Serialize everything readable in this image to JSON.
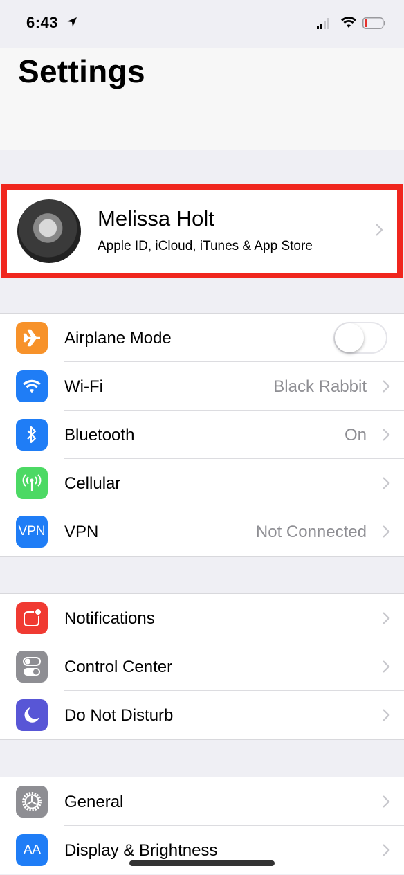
{
  "status_bar": {
    "time": "6:43",
    "battery_color": "#e5322d"
  },
  "header": {
    "title": "Settings"
  },
  "profile": {
    "name": "Melissa Holt",
    "subtitle": "Apple ID, iCloud, iTunes & App Store",
    "highlight_color": "#f0261e"
  },
  "groups": [
    {
      "rows": [
        {
          "label": "Airplane Mode",
          "icon": "airplane-icon",
          "icon_color": "#f7922a",
          "toggle": false
        },
        {
          "label": "Wi-Fi",
          "icon": "wifi-icon",
          "icon_color": "#1f7df6",
          "value": "Black Rabbit"
        },
        {
          "label": "Bluetooth",
          "icon": "bluetooth-icon",
          "icon_color": "#1f7df6",
          "value": "On"
        },
        {
          "label": "Cellular",
          "icon": "cellular-antenna-icon",
          "icon_color": "#4cd964",
          "value": ""
        },
        {
          "label": "VPN",
          "icon": "vpn-icon",
          "icon_text": "VPN",
          "icon_color": "#1f7df6",
          "value": "Not Connected"
        }
      ]
    },
    {
      "rows": [
        {
          "label": "Notifications",
          "icon": "notifications-icon",
          "icon_color": "#f03a32"
        },
        {
          "label": "Control Center",
          "icon": "control-center-icon",
          "icon_color": "#8e8e93"
        },
        {
          "label": "Do Not Disturb",
          "icon": "moon-icon",
          "icon_color": "#5856d6"
        }
      ]
    },
    {
      "rows": [
        {
          "label": "General",
          "icon": "gear-icon",
          "icon_color": "#8e8e93"
        },
        {
          "label": "Display & Brightness",
          "icon": "display-brightness-icon",
          "icon_text": "AA",
          "icon_color": "#1f7df6"
        }
      ]
    }
  ]
}
